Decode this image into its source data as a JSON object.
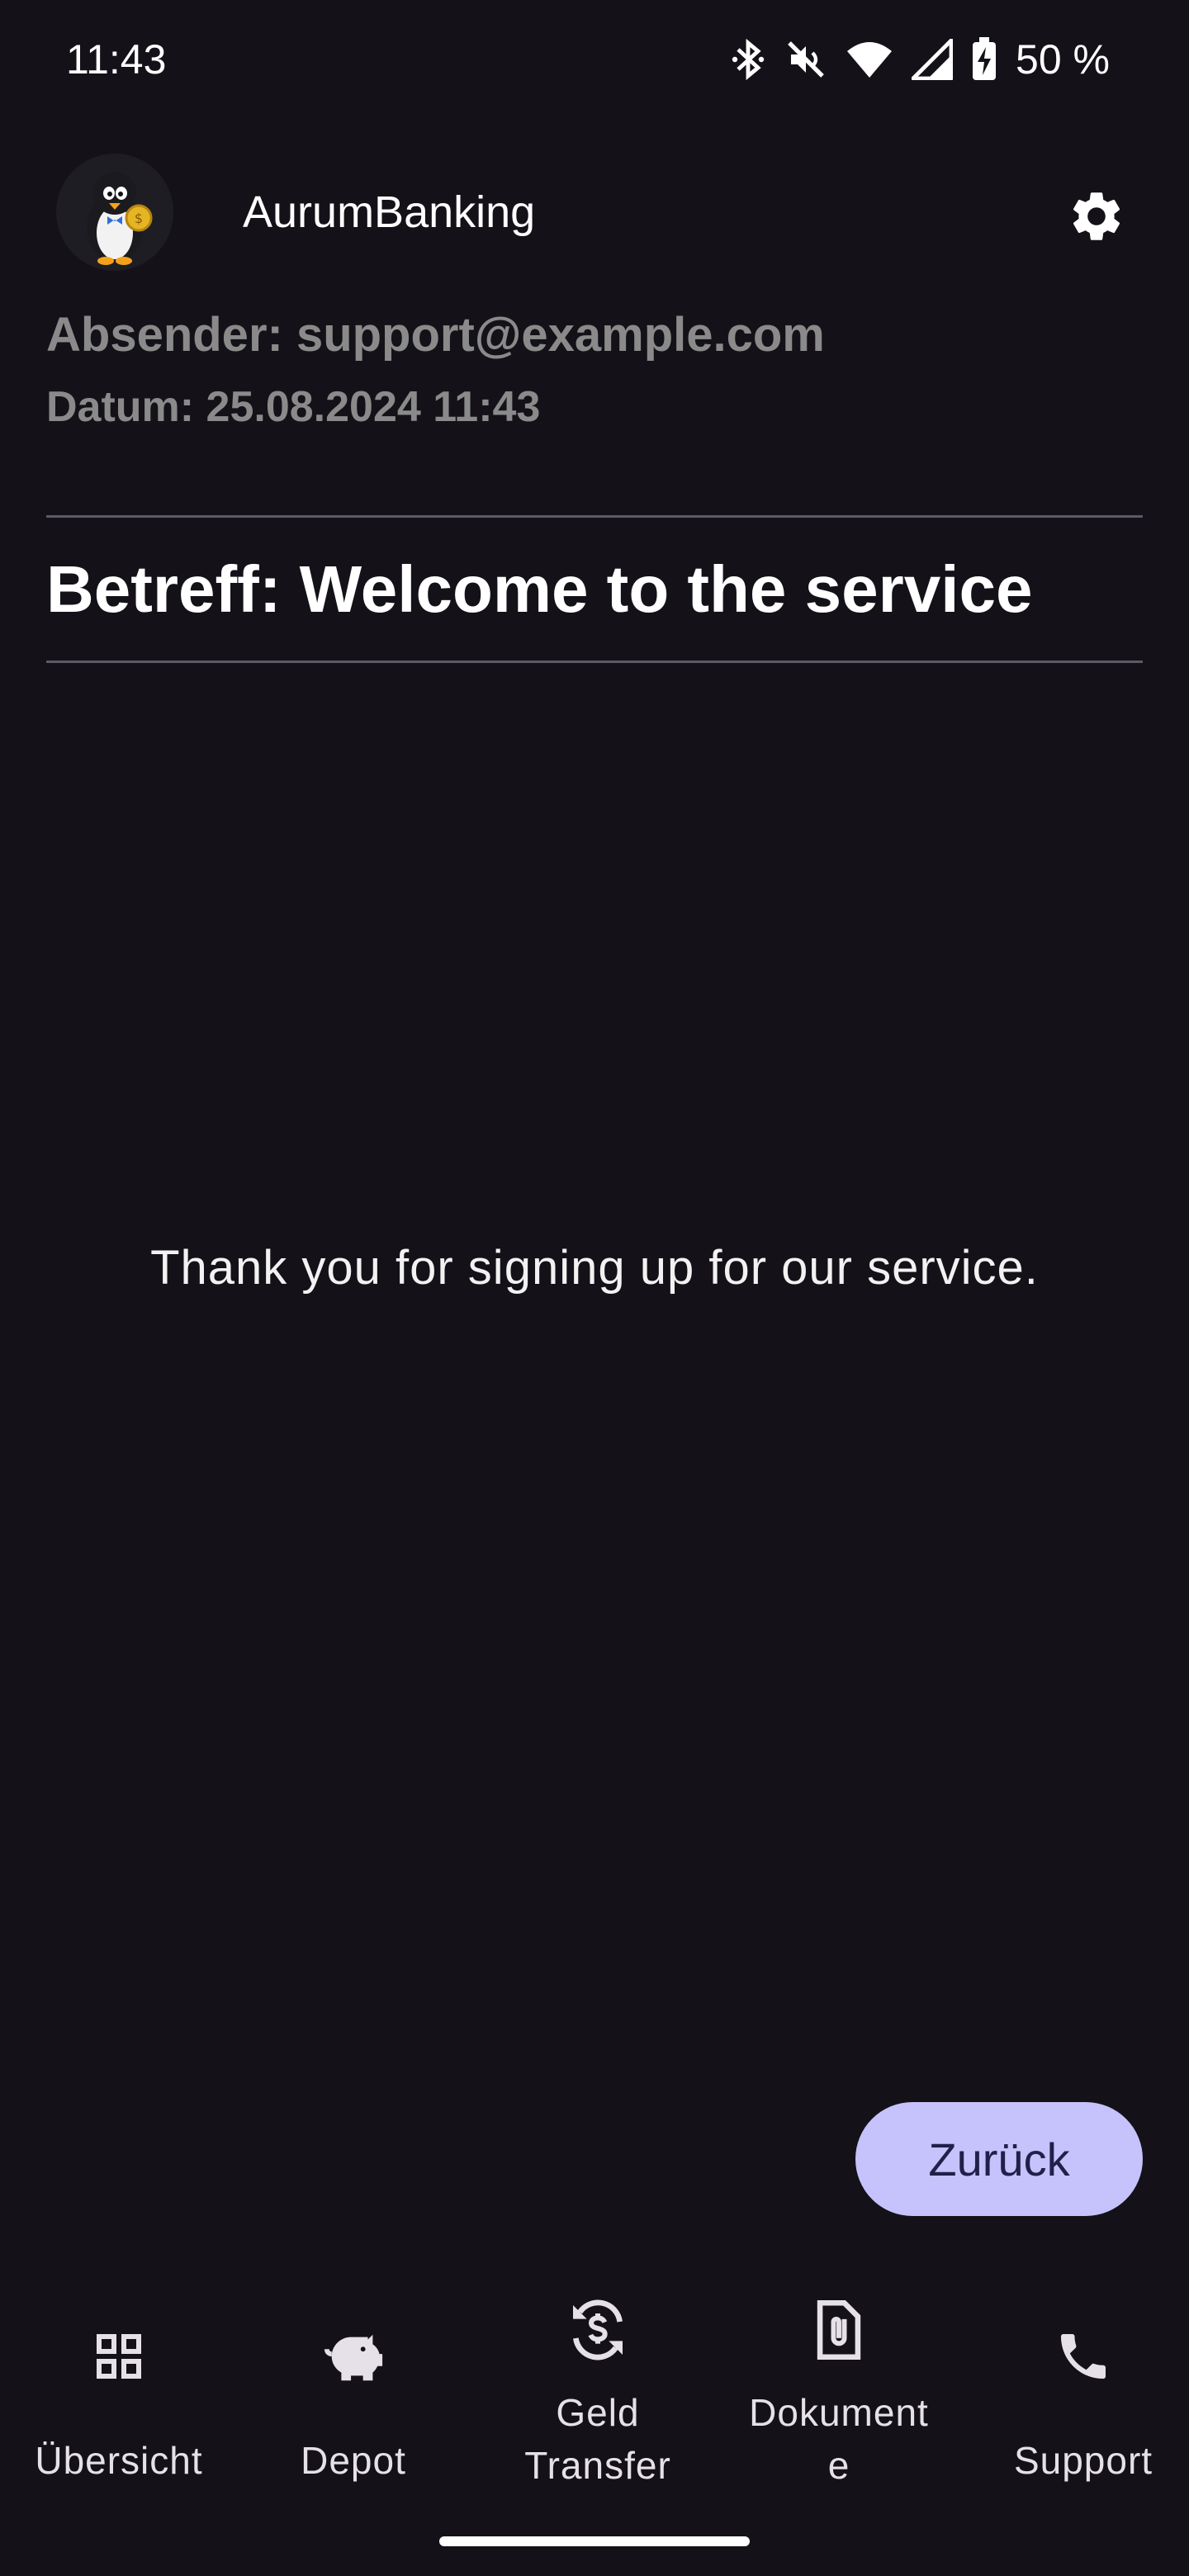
{
  "status_bar": {
    "time": "11:43",
    "battery": "50 %",
    "icons": [
      "bluetooth-icon",
      "mute-icon",
      "wifi-icon",
      "cell-signal-icon",
      "battery-charging-icon"
    ]
  },
  "app_bar": {
    "title": "AurumBanking",
    "logo_icon": "penguin-coin-logo",
    "settings_icon": "gear-icon"
  },
  "email": {
    "sender": "Absender: support@example.com",
    "date": "Datum: 25.08.2024 11:43",
    "subject": "Betreff: Welcome to the service",
    "body": "Thank you for signing up for our service."
  },
  "actions": {
    "back_label": "Zurück"
  },
  "bottom_nav": {
    "items": [
      {
        "label": "Übersicht",
        "icon": "grid-icon"
      },
      {
        "label": "Depot",
        "icon": "piggy-bank-icon"
      },
      {
        "label": "Geld\nTransfer",
        "icon": "currency-exchange-icon"
      },
      {
        "label": "Dokument\ne",
        "icon": "document-attachment-icon"
      },
      {
        "label": "Support",
        "icon": "phone-icon"
      }
    ]
  },
  "colors": {
    "background": "#141218",
    "button": "#c6c2fb",
    "button_text": "#22204a",
    "muted_text": "#8a8a8a",
    "divider": "#5e5a63"
  }
}
